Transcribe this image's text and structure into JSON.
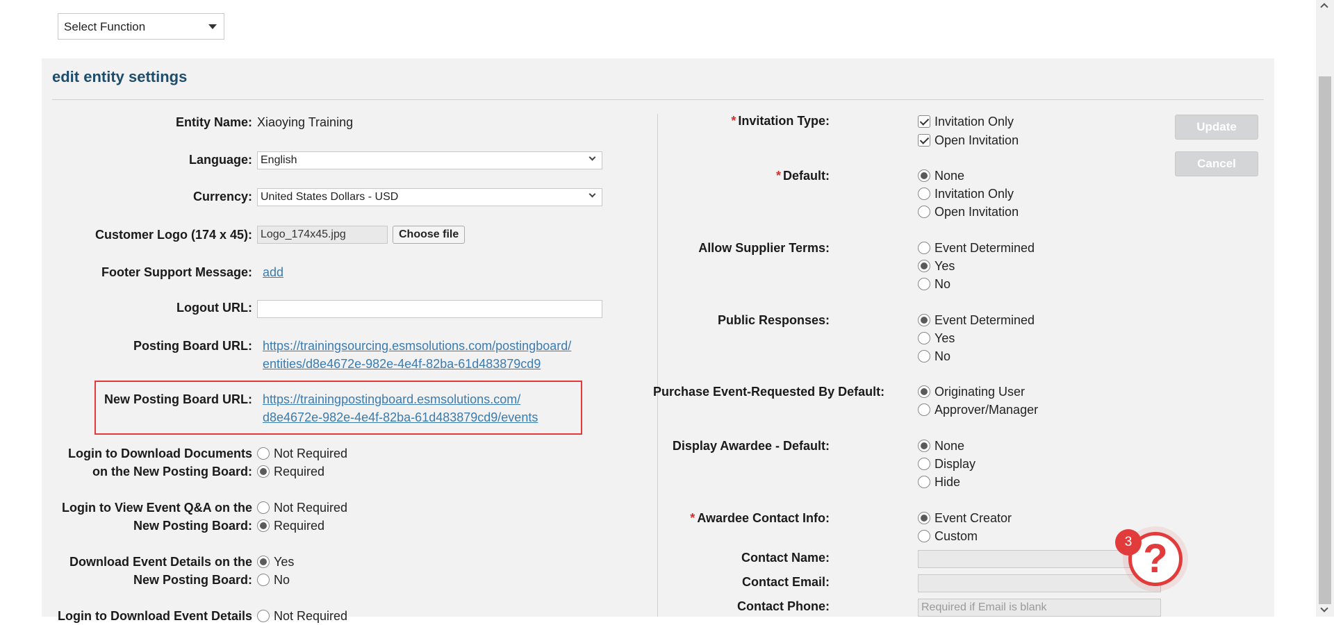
{
  "top": {
    "select_function": "Select Function"
  },
  "panel": {
    "title": "edit entity settings"
  },
  "left": {
    "entity_name": {
      "label": "Entity Name:",
      "value": "Xiaoying Training"
    },
    "language": {
      "label": "Language:",
      "value": "English"
    },
    "currency": {
      "label": "Currency:",
      "value": "United States Dollars - USD"
    },
    "logo": {
      "label": "Customer Logo (174 x 45):",
      "file": "Logo_174x45.jpg",
      "button": "Choose file"
    },
    "footer": {
      "label": "Footer Support Message:",
      "link": "add"
    },
    "logout": {
      "label": "Logout URL:",
      "value": ""
    },
    "posting_board": {
      "label": "Posting Board URL:",
      "line1": "https://trainingsourcing.esmsolutions.com/postingboard/",
      "line2": "entities/d8e4672e-982e-4e4f-82ba-61d483879cd9"
    },
    "new_posting_board": {
      "label": "New Posting Board URL:",
      "line1": "https://trainingpostingboard.esmsolutions.com/",
      "line2": "d8e4672e-982e-4e4f-82ba-61d483879cd9/events"
    },
    "login_download_docs": {
      "label1": "Login to Download Documents",
      "label2": "on the New Posting Board:",
      "opt1": "Not Required",
      "opt2": "Required"
    },
    "login_view_qa": {
      "label1": "Login to View Event Q&A on the",
      "label2": "New Posting Board:",
      "opt1": "Not Required",
      "opt2": "Required"
    },
    "download_event_details": {
      "label1": "Download Event Details on the",
      "label2": "New Posting Board:",
      "opt1": "Yes",
      "opt2": "No"
    },
    "login_download_event_details": {
      "label1": "Login to Download Event Details",
      "opt1": "Not Required"
    }
  },
  "right": {
    "invitation_type": {
      "label": "Invitation Type:",
      "opt1": "Invitation Only",
      "opt2": "Open Invitation"
    },
    "default": {
      "label": "Default:",
      "opt1": "None",
      "opt2": "Invitation Only",
      "opt3": "Open Invitation"
    },
    "supplier_terms": {
      "label": "Allow Supplier Terms:",
      "opt1": "Event Determined",
      "opt2": "Yes",
      "opt3": "No"
    },
    "public_responses": {
      "label": "Public Responses:",
      "opt1": "Event Determined",
      "opt2": "Yes",
      "opt3": "No"
    },
    "purchase_requested": {
      "label": "Purchase Event-Requested By Default:",
      "opt1": "Originating User",
      "opt2": "Approver/Manager"
    },
    "display_awardee": {
      "label": "Display Awardee - Default:",
      "opt1": "None",
      "opt2": "Display",
      "opt3": "Hide"
    },
    "awardee_contact": {
      "label": "Awardee Contact Info:",
      "opt1": "Event Creator",
      "opt2": "Custom"
    },
    "contact_name": {
      "label": "Contact Name:"
    },
    "contact_email": {
      "label": "Contact Email:"
    },
    "contact_phone": {
      "label": "Contact Phone:",
      "placeholder": "Required if Email is blank"
    },
    "update_button": "Update",
    "cancel_button": "Cancel"
  },
  "help": {
    "badge": "3",
    "glyph": "?"
  },
  "colors": {
    "title": "#1e4d6b",
    "link": "#3a7bb0",
    "highlight": "#e03a3a",
    "required": "#d32f2f"
  }
}
